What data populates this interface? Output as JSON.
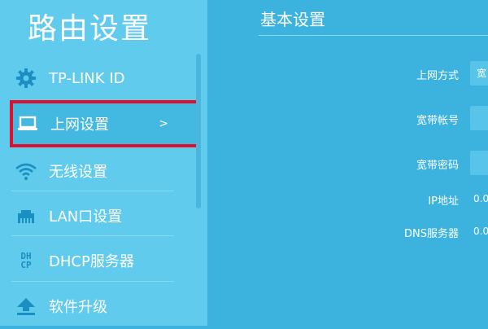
{
  "sidebar": {
    "title": "路由设置",
    "items": [
      {
        "label": "TP-LINK ID",
        "icon": "gear-icon"
      },
      {
        "label": "上网设置",
        "icon": "laptop-icon",
        "active": true,
        "chevron": ">"
      },
      {
        "label": "无线设置",
        "icon": "wifi-icon"
      },
      {
        "label": "LAN口设置",
        "icon": "lan-port-icon"
      },
      {
        "label": "DHCP服务器",
        "icon": "dhcp-icon",
        "icon_text_top": "DH",
        "icon_text_bottom": "CP"
      },
      {
        "label": "软件升级",
        "icon": "upgrade-icon"
      }
    ]
  },
  "main": {
    "title": "基本设置",
    "fields": [
      {
        "label": "上网方式",
        "value": "宽"
      },
      {
        "label": "宽带帐号",
        "value": ""
      },
      {
        "label": "宽带密码",
        "value": ""
      },
      {
        "label": "IP地址",
        "value": "0.0"
      },
      {
        "label": "DNS服务器",
        "value": "0.0"
      }
    ]
  },
  "colors": {
    "sidebar_bg": "#61cbed",
    "main_bg": "#3bb3de",
    "highlight_border": "#e0102d"
  }
}
